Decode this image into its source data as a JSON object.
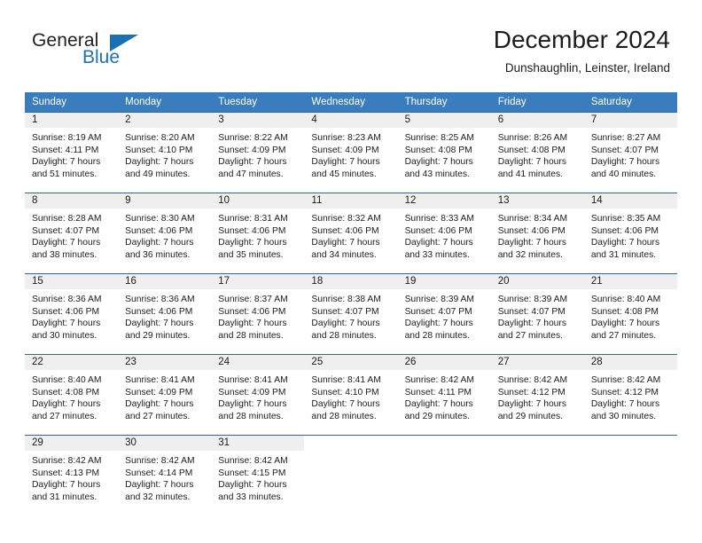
{
  "logo": {
    "word_one": "General",
    "word_two": "Blue",
    "icon": "triangle-logo-icon",
    "accent_color": "#1a6fb5"
  },
  "header": {
    "title": "December 2024",
    "subtitle": "Dunshaughlin, Leinster, Ireland"
  },
  "theme": {
    "header_row_bg": "#3a7dbf",
    "week_divider": "#2a68a8",
    "daynum_band_bg": "#efefef",
    "text_color": "#1c1c1c"
  },
  "calendar": {
    "weekday_headers": [
      "Sunday",
      "Monday",
      "Tuesday",
      "Wednesday",
      "Thursday",
      "Friday",
      "Saturday"
    ],
    "weeks": [
      [
        {
          "day": "1",
          "sunrise": "Sunrise: 8:19 AM",
          "sunset": "Sunset: 4:11 PM",
          "daylight1": "Daylight: 7 hours",
          "daylight2": "and 51 minutes."
        },
        {
          "day": "2",
          "sunrise": "Sunrise: 8:20 AM",
          "sunset": "Sunset: 4:10 PM",
          "daylight1": "Daylight: 7 hours",
          "daylight2": "and 49 minutes."
        },
        {
          "day": "3",
          "sunrise": "Sunrise: 8:22 AM",
          "sunset": "Sunset: 4:09 PM",
          "daylight1": "Daylight: 7 hours",
          "daylight2": "and 47 minutes."
        },
        {
          "day": "4",
          "sunrise": "Sunrise: 8:23 AM",
          "sunset": "Sunset: 4:09 PM",
          "daylight1": "Daylight: 7 hours",
          "daylight2": "and 45 minutes."
        },
        {
          "day": "5",
          "sunrise": "Sunrise: 8:25 AM",
          "sunset": "Sunset: 4:08 PM",
          "daylight1": "Daylight: 7 hours",
          "daylight2": "and 43 minutes."
        },
        {
          "day": "6",
          "sunrise": "Sunrise: 8:26 AM",
          "sunset": "Sunset: 4:08 PM",
          "daylight1": "Daylight: 7 hours",
          "daylight2": "and 41 minutes."
        },
        {
          "day": "7",
          "sunrise": "Sunrise: 8:27 AM",
          "sunset": "Sunset: 4:07 PM",
          "daylight1": "Daylight: 7 hours",
          "daylight2": "and 40 minutes."
        }
      ],
      [
        {
          "day": "8",
          "sunrise": "Sunrise: 8:28 AM",
          "sunset": "Sunset: 4:07 PM",
          "daylight1": "Daylight: 7 hours",
          "daylight2": "and 38 minutes."
        },
        {
          "day": "9",
          "sunrise": "Sunrise: 8:30 AM",
          "sunset": "Sunset: 4:06 PM",
          "daylight1": "Daylight: 7 hours",
          "daylight2": "and 36 minutes."
        },
        {
          "day": "10",
          "sunrise": "Sunrise: 8:31 AM",
          "sunset": "Sunset: 4:06 PM",
          "daylight1": "Daylight: 7 hours",
          "daylight2": "and 35 minutes."
        },
        {
          "day": "11",
          "sunrise": "Sunrise: 8:32 AM",
          "sunset": "Sunset: 4:06 PM",
          "daylight1": "Daylight: 7 hours",
          "daylight2": "and 34 minutes."
        },
        {
          "day": "12",
          "sunrise": "Sunrise: 8:33 AM",
          "sunset": "Sunset: 4:06 PM",
          "daylight1": "Daylight: 7 hours",
          "daylight2": "and 33 minutes."
        },
        {
          "day": "13",
          "sunrise": "Sunrise: 8:34 AM",
          "sunset": "Sunset: 4:06 PM",
          "daylight1": "Daylight: 7 hours",
          "daylight2": "and 32 minutes."
        },
        {
          "day": "14",
          "sunrise": "Sunrise: 8:35 AM",
          "sunset": "Sunset: 4:06 PM",
          "daylight1": "Daylight: 7 hours",
          "daylight2": "and 31 minutes."
        }
      ],
      [
        {
          "day": "15",
          "sunrise": "Sunrise: 8:36 AM",
          "sunset": "Sunset: 4:06 PM",
          "daylight1": "Daylight: 7 hours",
          "daylight2": "and 30 minutes."
        },
        {
          "day": "16",
          "sunrise": "Sunrise: 8:36 AM",
          "sunset": "Sunset: 4:06 PM",
          "daylight1": "Daylight: 7 hours",
          "daylight2": "and 29 minutes."
        },
        {
          "day": "17",
          "sunrise": "Sunrise: 8:37 AM",
          "sunset": "Sunset: 4:06 PM",
          "daylight1": "Daylight: 7 hours",
          "daylight2": "and 28 minutes."
        },
        {
          "day": "18",
          "sunrise": "Sunrise: 8:38 AM",
          "sunset": "Sunset: 4:07 PM",
          "daylight1": "Daylight: 7 hours",
          "daylight2": "and 28 minutes."
        },
        {
          "day": "19",
          "sunrise": "Sunrise: 8:39 AM",
          "sunset": "Sunset: 4:07 PM",
          "daylight1": "Daylight: 7 hours",
          "daylight2": "and 28 minutes."
        },
        {
          "day": "20",
          "sunrise": "Sunrise: 8:39 AM",
          "sunset": "Sunset: 4:07 PM",
          "daylight1": "Daylight: 7 hours",
          "daylight2": "and 27 minutes."
        },
        {
          "day": "21",
          "sunrise": "Sunrise: 8:40 AM",
          "sunset": "Sunset: 4:08 PM",
          "daylight1": "Daylight: 7 hours",
          "daylight2": "and 27 minutes."
        }
      ],
      [
        {
          "day": "22",
          "sunrise": "Sunrise: 8:40 AM",
          "sunset": "Sunset: 4:08 PM",
          "daylight1": "Daylight: 7 hours",
          "daylight2": "and 27 minutes."
        },
        {
          "day": "23",
          "sunrise": "Sunrise: 8:41 AM",
          "sunset": "Sunset: 4:09 PM",
          "daylight1": "Daylight: 7 hours",
          "daylight2": "and 27 minutes."
        },
        {
          "day": "24",
          "sunrise": "Sunrise: 8:41 AM",
          "sunset": "Sunset: 4:09 PM",
          "daylight1": "Daylight: 7 hours",
          "daylight2": "and 28 minutes."
        },
        {
          "day": "25",
          "sunrise": "Sunrise: 8:41 AM",
          "sunset": "Sunset: 4:10 PM",
          "daylight1": "Daylight: 7 hours",
          "daylight2": "and 28 minutes."
        },
        {
          "day": "26",
          "sunrise": "Sunrise: 8:42 AM",
          "sunset": "Sunset: 4:11 PM",
          "daylight1": "Daylight: 7 hours",
          "daylight2": "and 29 minutes."
        },
        {
          "day": "27",
          "sunrise": "Sunrise: 8:42 AM",
          "sunset": "Sunset: 4:12 PM",
          "daylight1": "Daylight: 7 hours",
          "daylight2": "and 29 minutes."
        },
        {
          "day": "28",
          "sunrise": "Sunrise: 8:42 AM",
          "sunset": "Sunset: 4:12 PM",
          "daylight1": "Daylight: 7 hours",
          "daylight2": "and 30 minutes."
        }
      ],
      [
        {
          "day": "29",
          "sunrise": "Sunrise: 8:42 AM",
          "sunset": "Sunset: 4:13 PM",
          "daylight1": "Daylight: 7 hours",
          "daylight2": "and 31 minutes."
        },
        {
          "day": "30",
          "sunrise": "Sunrise: 8:42 AM",
          "sunset": "Sunset: 4:14 PM",
          "daylight1": "Daylight: 7 hours",
          "daylight2": "and 32 minutes."
        },
        {
          "day": "31",
          "sunrise": "Sunrise: 8:42 AM",
          "sunset": "Sunset: 4:15 PM",
          "daylight1": "Daylight: 7 hours",
          "daylight2": "and 33 minutes."
        },
        {
          "day": "",
          "sunrise": "",
          "sunset": "",
          "daylight1": "",
          "daylight2": ""
        },
        {
          "day": "",
          "sunrise": "",
          "sunset": "",
          "daylight1": "",
          "daylight2": ""
        },
        {
          "day": "",
          "sunrise": "",
          "sunset": "",
          "daylight1": "",
          "daylight2": ""
        },
        {
          "day": "",
          "sunrise": "",
          "sunset": "",
          "daylight1": "",
          "daylight2": ""
        }
      ]
    ]
  }
}
